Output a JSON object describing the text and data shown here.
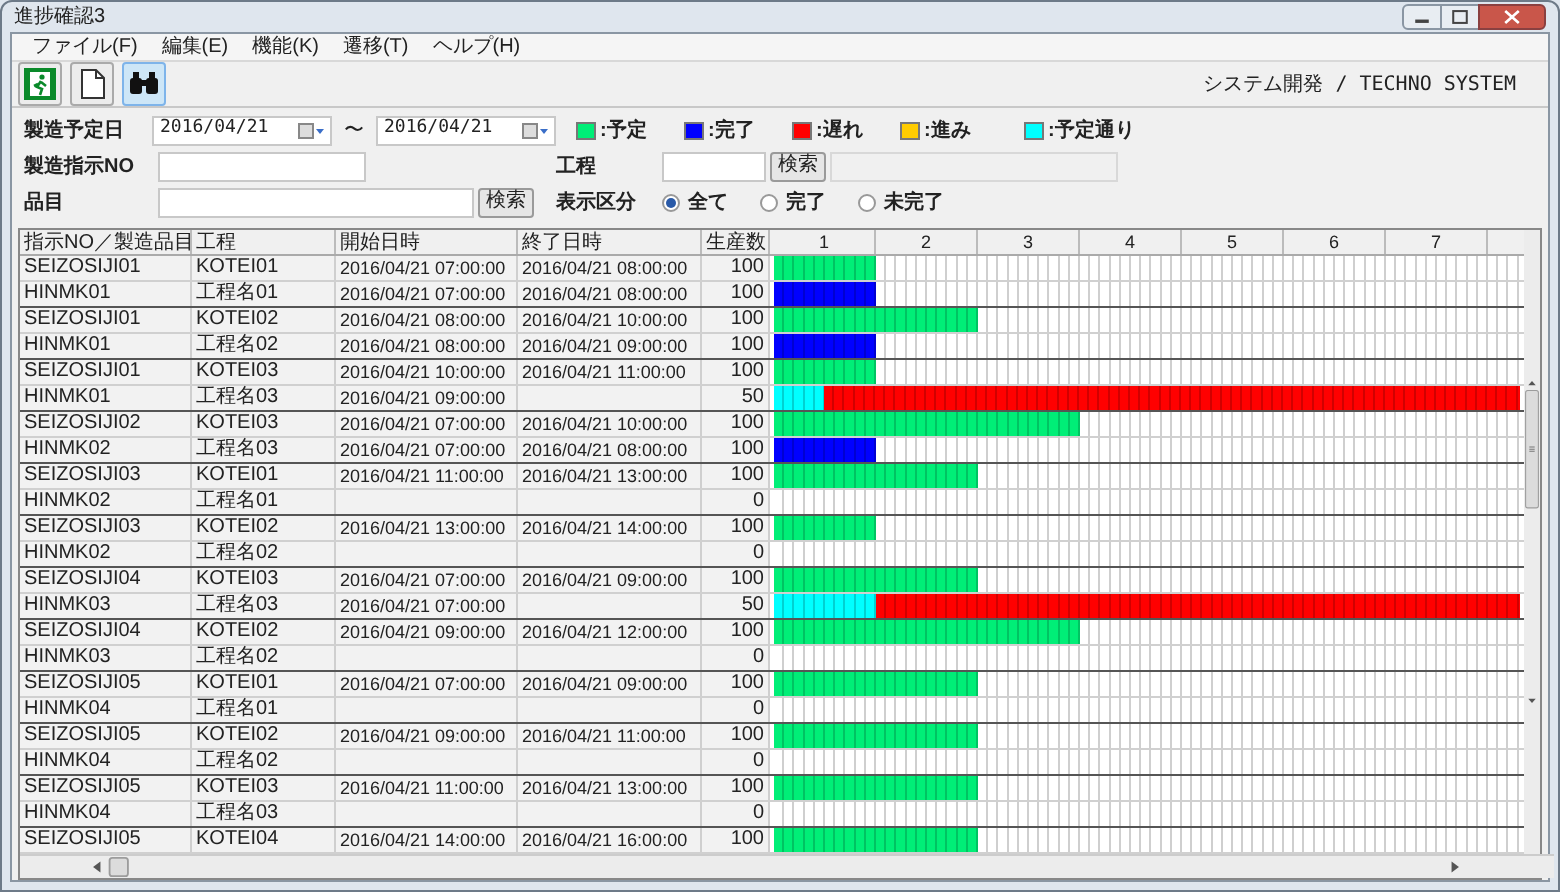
{
  "window": {
    "title": "進捗確認3"
  },
  "menu": [
    "ファイル(F)",
    "編集(E)",
    "機能(K)",
    "遷移(T)",
    "ヘルプ(H)"
  ],
  "toolbar": [
    {
      "kind": "exit",
      "selected": false
    },
    {
      "kind": "new",
      "selected": false
    },
    {
      "kind": "search",
      "selected": true
    }
  ],
  "company": "システム開発 / TECHNO SYSTEM",
  "filters": {
    "date_label": "製造予定日",
    "date_from": "2016/04/21",
    "range_separator": "〜",
    "date_to": "2016/04/21",
    "order_label": "製造指示NO",
    "process_label": "工程",
    "process_search": "検索",
    "item_label": "品目",
    "item_search": "検索",
    "display_label": "表示区分",
    "display_options": [
      {
        "label": "全て",
        "selected": true
      },
      {
        "label": "完了",
        "selected": false
      },
      {
        "label": "未完了",
        "selected": false
      }
    ]
  },
  "legend": [
    {
      "label": ":予定",
      "color": "#00ee77"
    },
    {
      "label": ":完了",
      "color": "#0000ff"
    },
    {
      "label": ":遅れ",
      "color": "#ff0000"
    },
    {
      "label": ":進み",
      "color": "#ffcc00"
    },
    {
      "label": ":予定通り",
      "color": "#00ffff"
    }
  ],
  "table": {
    "columns": [
      "指示NO／製造品目",
      "工程",
      "開始日時",
      "終了日時",
      "生産数"
    ],
    "hours": [
      "1",
      "2",
      "3",
      "4",
      "5",
      "6",
      "7"
    ],
    "rows": [
      {
        "cells": [
          "SEIZOSIJI01",
          "KOTEI01",
          "2016/04/21 07:00:00",
          "2016/04/21 08:00:00",
          "100"
        ],
        "bars": [
          {
            "color": "#00ee77",
            "level": 0.137
          }
        ]
      },
      {
        "cells": [
          "HINMK01",
          "工程名01",
          "2016/04/21 07:00:00",
          "2016/04/21 08:00:00",
          "100"
        ],
        "bars": [
          {
            "color": "#0000ff",
            "level": 0.137
          }
        ]
      },
      {
        "cells": [
          "SEIZOSIJI01",
          "KOTEI02",
          "2016/04/21 08:00:00",
          "2016/04/21 10:00:00",
          "100"
        ],
        "bars": [
          {
            "color": "#00ee77",
            "level": 0.274
          }
        ]
      },
      {
        "cells": [
          "HINMK01",
          "工程名02",
          "2016/04/21 08:00:00",
          "2016/04/21 09:00:00",
          "100"
        ],
        "bars": [
          {
            "color": "#0000ff",
            "level": 0.137
          }
        ]
      },
      {
        "cells": [
          "SEIZOSIJI01",
          "KOTEI03",
          "2016/04/21 10:00:00",
          "2016/04/21 11:00:00",
          "100"
        ],
        "bars": [
          {
            "color": "#00ee77",
            "level": 0.137
          }
        ]
      },
      {
        "cells": [
          "HINMK01",
          "工程名03",
          "2016/04/21 09:00:00",
          "",
          "50"
        ],
        "bars": [
          {
            "color": "#00ffff",
            "level": 0.068
          },
          {
            "color": "#ff0000",
            "level": 0.932
          }
        ]
      },
      {
        "cells": [
          "SEIZOSIJI02",
          "KOTEI03",
          "2016/04/21 07:00:00",
          "2016/04/21 10:00:00",
          "100"
        ],
        "bars": [
          {
            "color": "#00ee77",
            "level": 0.41
          }
        ]
      },
      {
        "cells": [
          "HINMK02",
          "工程名03",
          "2016/04/21 07:00:00",
          "2016/04/21 08:00:00",
          "100"
        ],
        "bars": [
          {
            "color": "#0000ff",
            "level": 0.137
          }
        ]
      },
      {
        "cells": [
          "SEIZOSIJI03",
          "KOTEI01",
          "2016/04/21 11:00:00",
          "2016/04/21 13:00:00",
          "100"
        ],
        "bars": [
          {
            "color": "#00ee77",
            "level": 0.274
          }
        ]
      },
      {
        "cells": [
          "HINMK02",
          "工程名01",
          "",
          "",
          "0"
        ]
      },
      {
        "cells": [
          "SEIZOSIJI03",
          "KOTEI02",
          "2016/04/21 13:00:00",
          "2016/04/21 14:00:00",
          "100"
        ],
        "bars": [
          {
            "color": "#00ee77",
            "level": 0.137
          }
        ]
      },
      {
        "cells": [
          "HINMK02",
          "工程名02",
          "",
          "",
          "0"
        ]
      },
      {
        "cells": [
          "SEIZOSIJI04",
          "KOTEI03",
          "2016/04/21 07:00:00",
          "2016/04/21 09:00:00",
          "100"
        ],
        "bars": [
          {
            "color": "#00ee77",
            "level": 0.274
          }
        ]
      },
      {
        "cells": [
          "HINMK03",
          "工程名03",
          "2016/04/21 07:00:00",
          "",
          "50"
        ],
        "bars": [
          {
            "color": "#00ffff",
            "level": 0.137
          },
          {
            "color": "#ff0000",
            "level": 0.863
          }
        ]
      },
      {
        "cells": [
          "SEIZOSIJI04",
          "KOTEI02",
          "2016/04/21 09:00:00",
          "2016/04/21 12:00:00",
          "100"
        ],
        "bars": [
          {
            "color": "#00ee77",
            "level": 0.41
          }
        ]
      },
      {
        "cells": [
          "HINMK03",
          "工程名02",
          "",
          "",
          "0"
        ]
      },
      {
        "cells": [
          "SEIZOSIJI05",
          "KOTEI01",
          "2016/04/21 07:00:00",
          "2016/04/21 09:00:00",
          "100"
        ],
        "bars": [
          {
            "color": "#00ee77",
            "level": 0.274
          }
        ]
      },
      {
        "cells": [
          "HINMK04",
          "工程名01",
          "",
          "",
          "0"
        ]
      },
      {
        "cells": [
          "SEIZOSIJI05",
          "KOTEI02",
          "2016/04/21 09:00:00",
          "2016/04/21 11:00:00",
          "100"
        ],
        "bars": [
          {
            "color": "#00ee77",
            "level": 0.274
          }
        ]
      },
      {
        "cells": [
          "HINMK04",
          "工程名02",
          "",
          "",
          "0"
        ]
      },
      {
        "cells": [
          "SEIZOSIJI05",
          "KOTEI03",
          "2016/04/21 11:00:00",
          "2016/04/21 13:00:00",
          "100"
        ],
        "bars": [
          {
            "color": "#00ee77",
            "level": 0.274
          }
        ]
      },
      {
        "cells": [
          "HINMK04",
          "工程名03",
          "",
          "",
          "0"
        ]
      },
      {
        "cells": [
          "SEIZOSIJI05",
          "KOTEI04",
          "2016/04/21 14:00:00",
          "2016/04/21 16:00:00",
          "100"
        ],
        "bars": [
          {
            "color": "#00ee77",
            "level": 0.274
          }
        ]
      }
    ]
  }
}
